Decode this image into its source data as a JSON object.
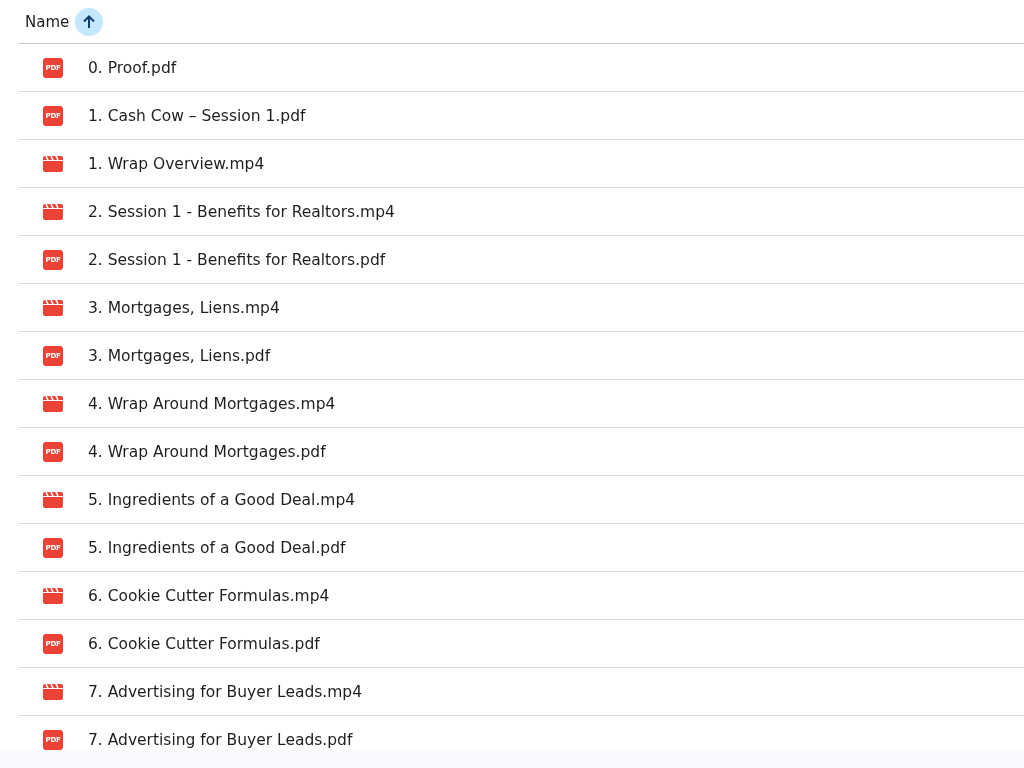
{
  "header": {
    "label": "Name",
    "ascending": true
  },
  "files": [
    {
      "name": "0. Proof.pdf",
      "kind": "pdf",
      "badge": "PDF"
    },
    {
      "name": "1. Cash Cow – Session 1.pdf",
      "kind": "pdf",
      "badge": "PDF"
    },
    {
      "name": "1. Wrap Overview.mp4",
      "kind": "video"
    },
    {
      "name": "2. Session 1 - Benefits for Realtors.mp4",
      "kind": "video"
    },
    {
      "name": "2. Session 1 - Benefits for Realtors.pdf",
      "kind": "pdf",
      "badge": "PDF"
    },
    {
      "name": "3. Mortgages, Liens.mp4",
      "kind": "video"
    },
    {
      "name": "3. Mortgages, Liens.pdf",
      "kind": "pdf",
      "badge": "PDF"
    },
    {
      "name": "4. Wrap Around Mortgages.mp4",
      "kind": "video"
    },
    {
      "name": "4. Wrap Around Mortgages.pdf",
      "kind": "pdf",
      "badge": "PDF"
    },
    {
      "name": "5. Ingredients of a Good Deal.mp4",
      "kind": "video"
    },
    {
      "name": "5. Ingredients of a Good Deal.pdf",
      "kind": "pdf",
      "badge": "PDF"
    },
    {
      "name": "6. Cookie Cutter Formulas.mp4",
      "kind": "video"
    },
    {
      "name": "6. Cookie Cutter Formulas.pdf",
      "kind": "pdf",
      "badge": "PDF"
    },
    {
      "name": "7. Advertising for Buyer Leads.mp4",
      "kind": "video"
    },
    {
      "name": "7. Advertising for Buyer Leads.pdf",
      "kind": "pdf",
      "badge": "PDF"
    }
  ]
}
